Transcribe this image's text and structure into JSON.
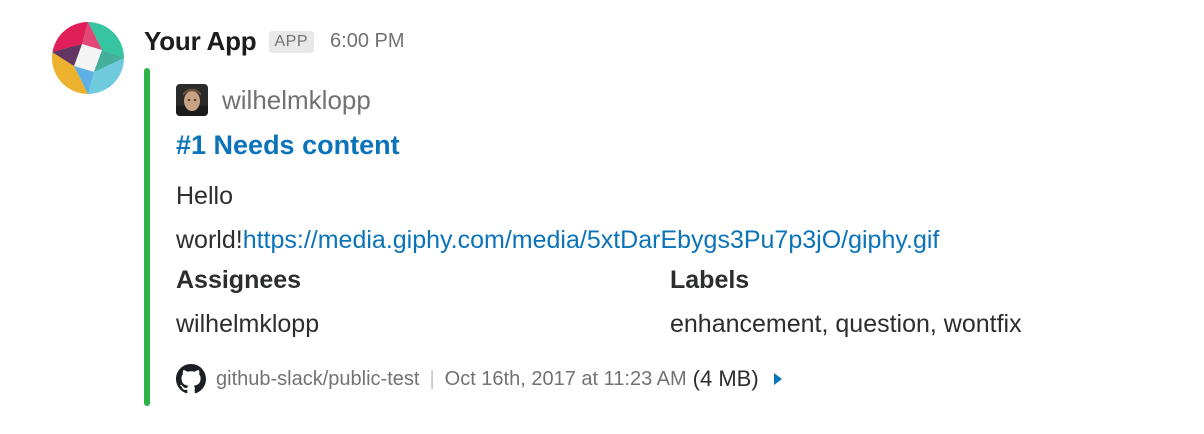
{
  "message": {
    "app_name": "Your App",
    "app_badge": "APP",
    "timestamp": "6:00 PM",
    "avatar_icon": "slack-logo-icon"
  },
  "attachment": {
    "color": "#2eb444",
    "author_name": "wilhelmklopp",
    "author_icon": "user-avatar",
    "title": "#1 Needs content",
    "text_line1": "Hello",
    "text_line2_prefix": "world!",
    "text_link": "https://media.giphy.com/media/5xtDarEbygs3Pu7p3jO/giphy.gif",
    "fields": [
      {
        "title": "Assignees",
        "value": "wilhelmklopp"
      },
      {
        "title": "Labels",
        "value": "enhancement, question, wontfix"
      }
    ],
    "footer": {
      "icon": "github-icon",
      "text": "github-slack/public-test",
      "date": "Oct 16th, 2017 at 11:23 AM",
      "size": "(4 MB)",
      "expand_icon": "caret-right-icon"
    }
  },
  "colors": {
    "link": "#0b73b9",
    "muted": "#717274",
    "accent_bar": "#2eb444"
  }
}
